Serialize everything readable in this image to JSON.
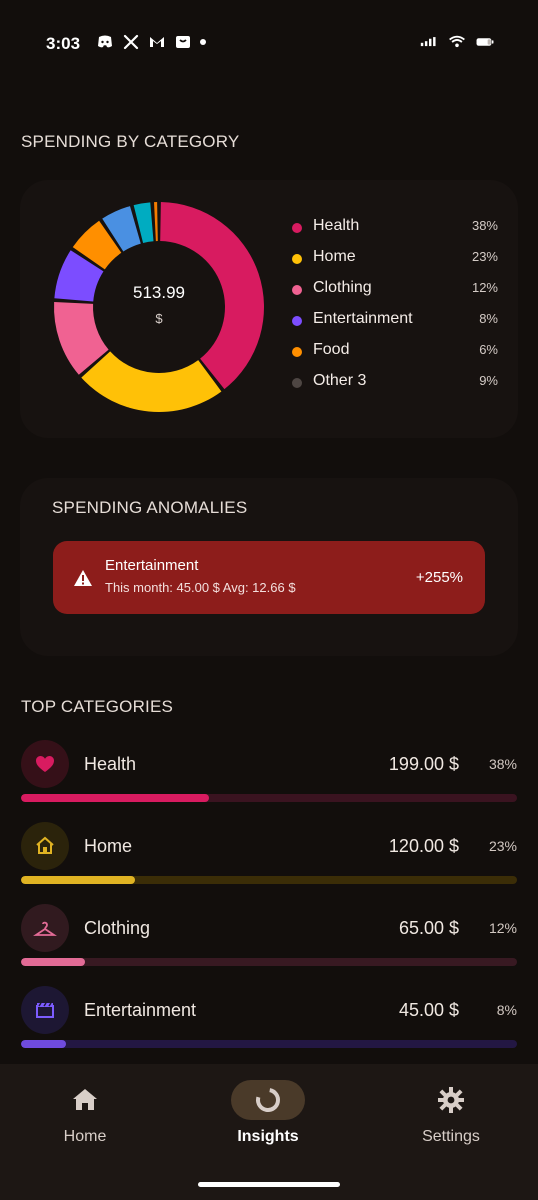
{
  "status_bar": {
    "time": "3:03",
    "left_icons": [
      "discord-icon",
      "x-icon",
      "gmail-icon",
      "shopping-bag-icon",
      "dot-icon"
    ],
    "right_icons": [
      "signal-icon",
      "wifi-icon",
      "battery-icon"
    ]
  },
  "colors": {
    "background": "#120e0c",
    "card": "#171210",
    "health": "#d81b60",
    "home": "#ffc107",
    "clothing": "#f06292",
    "entertainment": "#7c4dff",
    "food": "#ff8f00",
    "other": "#4e4643",
    "anomaly": "#8d1d1b"
  },
  "spending_by_category": {
    "title": "SPENDING BY CATEGORY",
    "total": "513.99",
    "currency": "$",
    "legend": [
      {
        "label": "Health",
        "percent": "38%",
        "color": "#d81b60"
      },
      {
        "label": "Home",
        "percent": "23%",
        "color": "#ffc107"
      },
      {
        "label": "Clothing",
        "percent": "12%",
        "color": "#f06292"
      },
      {
        "label": "Entertainment",
        "percent": "8%",
        "color": "#7c4dff"
      },
      {
        "label": "Food",
        "percent": "6%",
        "color": "#ff8f00"
      },
      {
        "label": "Other 3",
        "percent": "9%",
        "color": "#4e4643"
      }
    ]
  },
  "chart_data": {
    "type": "pie",
    "categories": [
      "Health",
      "Home",
      "Clothing",
      "Entertainment",
      "Food",
      "Other 3"
    ],
    "values": [
      38,
      23,
      12,
      8,
      6,
      9
    ],
    "slices": [
      {
        "label": "Health",
        "value": 38,
        "color": "#d81b60"
      },
      {
        "label": "Home",
        "value": 23,
        "color": "#ffc107"
      },
      {
        "label": "Clothing",
        "value": 12,
        "color": "#f06292"
      },
      {
        "label": "Entertainment",
        "value": 8,
        "color": "#7c4dff"
      },
      {
        "label": "Food",
        "value": 6,
        "color": "#ff8f00"
      },
      {
        "label": "Other 3",
        "value": 9,
        "color": "#4e4643"
      }
    ],
    "hidden_other_slices": [
      {
        "value": 5,
        "color": "#4a90e2"
      },
      {
        "value": 3,
        "color": "#00acc1"
      },
      {
        "value": 1,
        "color": "#f57c00"
      }
    ],
    "title": "SPENDING BY CATEGORY"
  },
  "spending_anomalies": {
    "title": "SPENDING ANOMALIES",
    "items": [
      {
        "category": "Entertainment",
        "detail": "This month: 45.00 $  Avg: 12.66 $",
        "change": "+255%"
      }
    ]
  },
  "top_categories": {
    "title": "TOP CATEGORIES",
    "items": [
      {
        "name": "Health",
        "amount": "199.00 $",
        "percent": "38%",
        "progress": 0.38,
        "icon": "heart-icon",
        "color": "#d81b60",
        "track": "#3a1320",
        "icon_bg": "#351018"
      },
      {
        "name": "Home",
        "amount": "120.00 $",
        "percent": "23%",
        "progress": 0.23,
        "icon": "house-icon",
        "color": "#e0b323",
        "track": "#3b2d07",
        "icon_bg": "#2b230b"
      },
      {
        "name": "Clothing",
        "amount": "65.00 $",
        "percent": "12%",
        "progress": 0.13,
        "icon": "hanger-icon",
        "color": "#e26b96",
        "track": "#381922",
        "icon_bg": "#311a1f"
      },
      {
        "name": "Entertainment",
        "amount": "45.00 $",
        "percent": "8%",
        "progress": 0.09,
        "icon": "clapperboard-icon",
        "color": "#6f4bdd",
        "track": "#231743",
        "icon_bg": "#1d1733"
      }
    ]
  },
  "bottom_nav": {
    "items": [
      {
        "label": "Home",
        "icon": "home-icon",
        "active": false
      },
      {
        "label": "Insights",
        "icon": "donut-chart-icon",
        "active": true
      },
      {
        "label": "Settings",
        "icon": "gear-icon",
        "active": false
      }
    ]
  }
}
